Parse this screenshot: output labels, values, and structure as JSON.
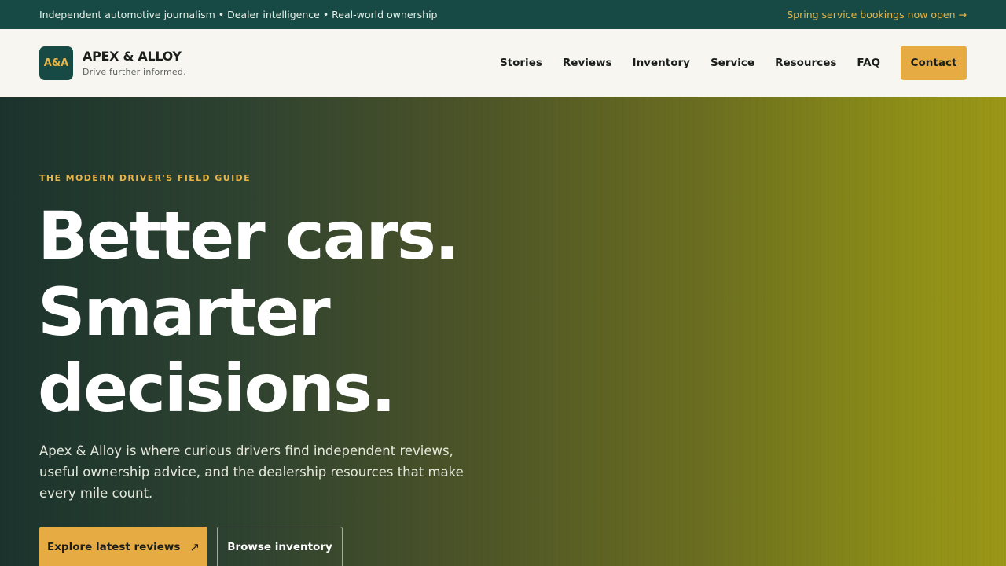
{
  "topbar": {
    "left_text": "Independent automotive journalism • Dealer intelligence • Real-world ownership",
    "right_text": "Spring service bookings now open →"
  },
  "brand": {
    "logo_text": "A&A",
    "name": "APEX & ALLOY",
    "tagline": "Drive further informed."
  },
  "nav": {
    "items": [
      "Stories",
      "Reviews",
      "Inventory",
      "Service",
      "Resources",
      "FAQ"
    ],
    "contact_label": "Contact"
  },
  "hero": {
    "eyebrow": "THE MODERN DRIVER'S FIELD GUIDE",
    "headline_lines": [
      "Better cars.",
      "Smarter",
      "decisions."
    ],
    "lede": "Apex & Alloy is where curious drivers find independent reviews, useful ownership advice, and the dealership resources that make every mile count.",
    "primary_button": "Explore latest reviews",
    "primary_button_icon": "↗",
    "secondary_button": "Browse inventory"
  },
  "colors": {
    "topbar_bg": "#184a45",
    "accent": "#e6ab43",
    "header_bg": "#f8f6f0"
  }
}
